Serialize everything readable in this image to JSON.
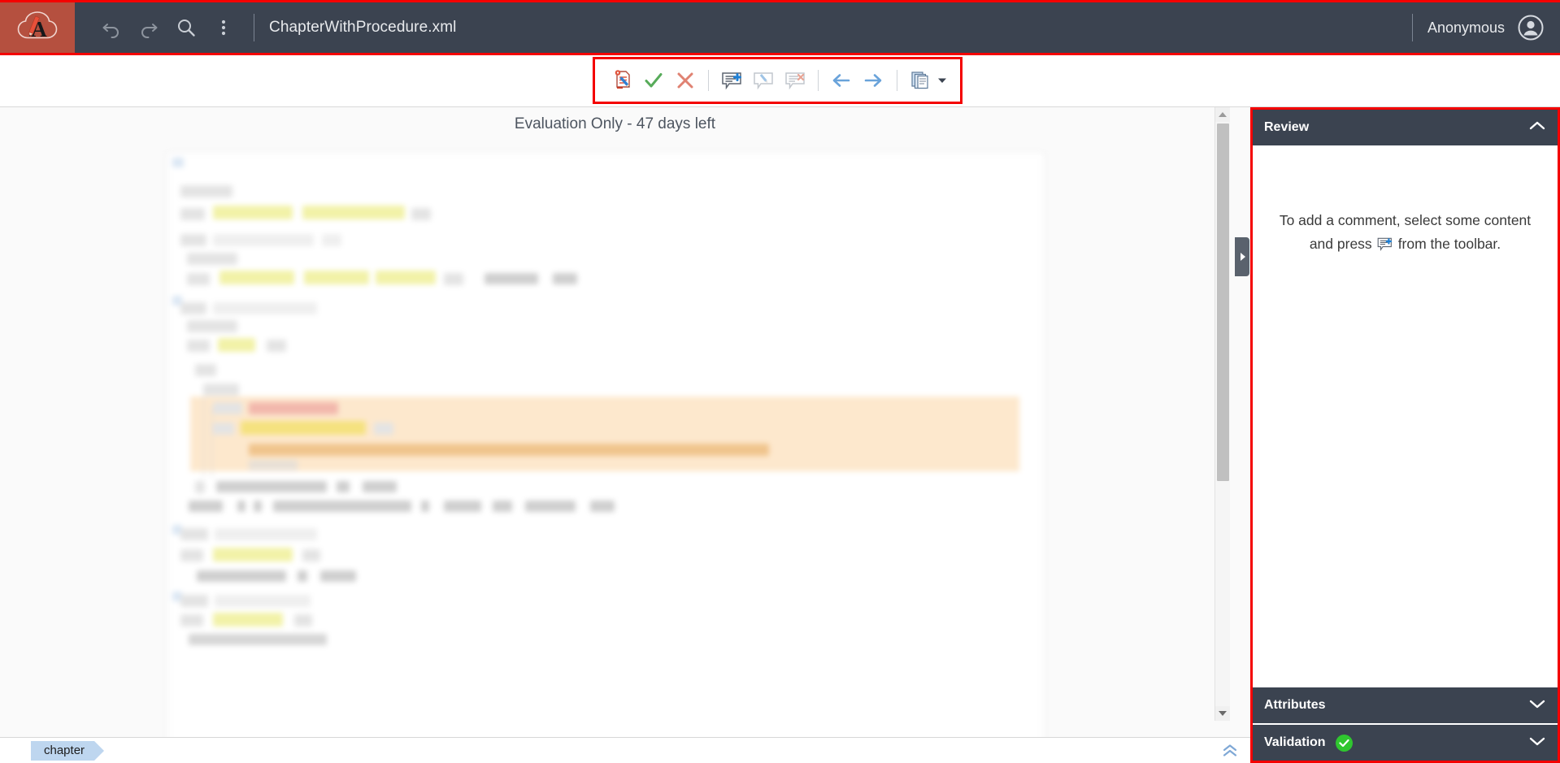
{
  "app": {
    "logo_name": "oxygen-xml-web-author-logo",
    "brand_color": "#b5503f",
    "header_color": "#3b4350",
    "highlight_border_color": "#f40000",
    "document_title": "ChapterWithProcedure.xml",
    "user_label": "Anonymous"
  },
  "header_tools": [
    {
      "name": "undo-icon",
      "label": "Undo"
    },
    {
      "name": "redo-icon",
      "label": "Redo"
    },
    {
      "name": "search-icon",
      "label": "Find/Replace"
    },
    {
      "name": "more-options-icon",
      "label": "More options"
    }
  ],
  "review_toolbar": {
    "items": [
      {
        "name": "track-changes-icon",
        "label": "Track Changes",
        "state": "enabled"
      },
      {
        "name": "accept-change-icon",
        "label": "Accept Change",
        "state": "enabled"
      },
      {
        "name": "reject-change-icon",
        "label": "Reject Change",
        "state": "enabled"
      },
      {
        "name": "add-comment-icon",
        "label": "Add Comment",
        "state": "enabled"
      },
      {
        "name": "edit-comment-icon",
        "label": "Edit Comment",
        "state": "disabled"
      },
      {
        "name": "remove-comment-icon",
        "label": "Remove Comment",
        "state": "disabled"
      },
      {
        "name": "previous-change-icon",
        "label": "Previous Change",
        "state": "enabled"
      },
      {
        "name": "next-change-icon",
        "label": "Next Change",
        "state": "enabled"
      },
      {
        "name": "manage-reviews-icon",
        "label": "Manage Reviews",
        "state": "enabled"
      },
      {
        "name": "dropdown-caret-icon",
        "label": "More",
        "state": "enabled"
      }
    ]
  },
  "main": {
    "evaluation_notice": "Evaluation Only - 47 days left"
  },
  "side_panel": {
    "review": {
      "title": "Review",
      "collapse_icon": "chevron-up-icon",
      "empty_text_before": "To add a comment, select some content and press",
      "empty_text_after": "from the toolbar.",
      "empty_inline_icon": "add-comment-icon"
    },
    "attributes": {
      "title": "Attributes",
      "collapse_icon": "chevron-down-icon"
    },
    "validation": {
      "title": "Validation",
      "status_icon": "valid-check-icon",
      "status_color": "#2fc62f",
      "collapse_icon": "chevron-down-icon"
    }
  },
  "status_bar": {
    "breadcrumb": [
      "chapter"
    ],
    "collapse_icon": "double-chevron-up-icon"
  }
}
